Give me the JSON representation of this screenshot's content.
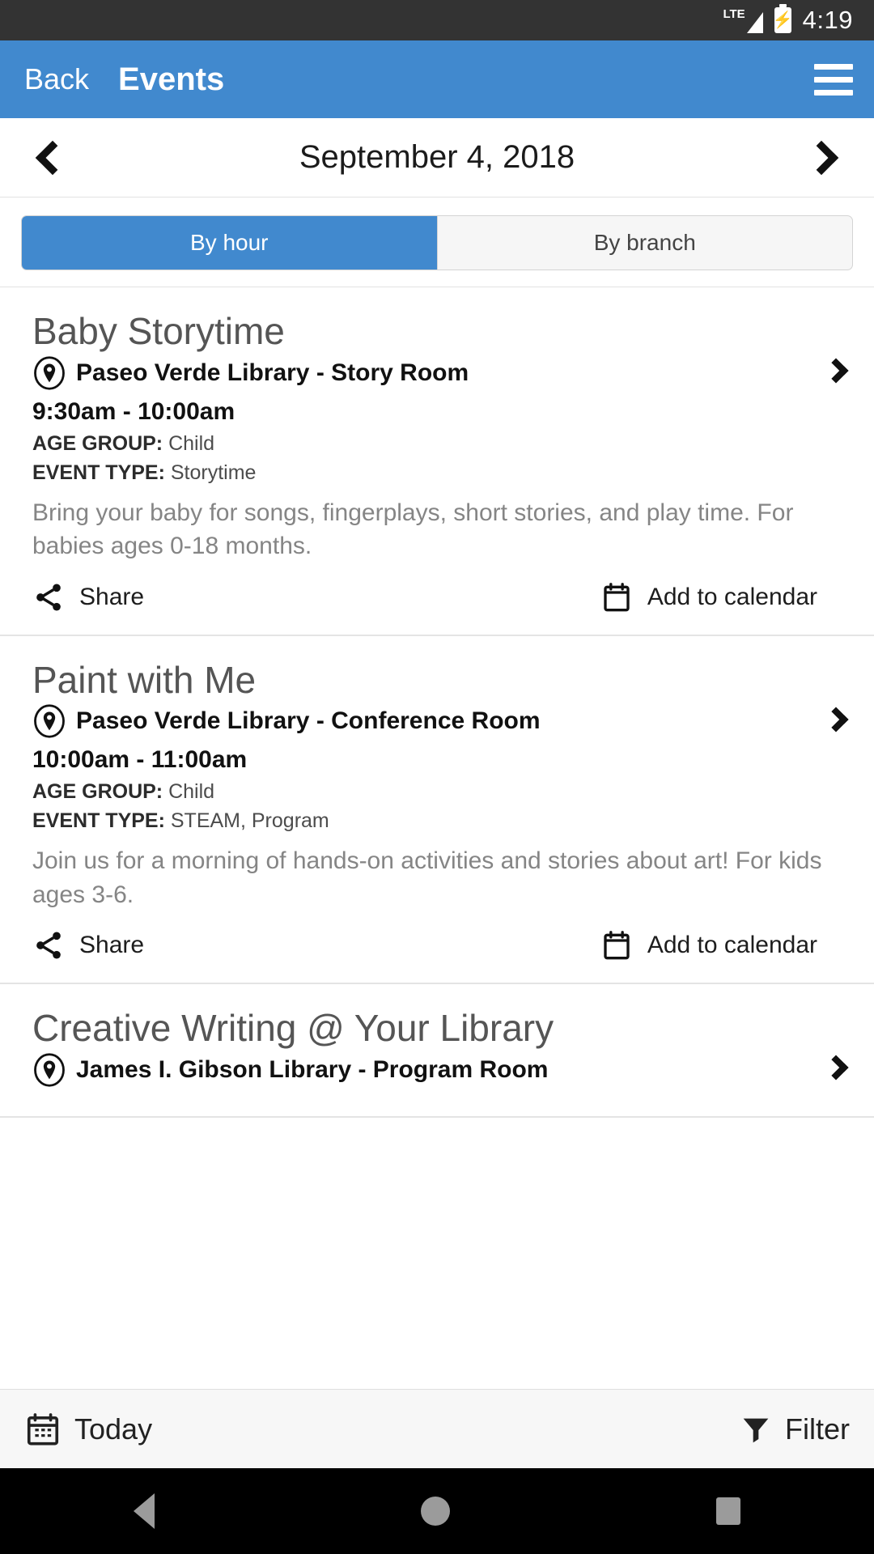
{
  "status_bar": {
    "network_label": "LTE",
    "time": "4:19",
    "battery_icon": "battery-charging-icon"
  },
  "app_bar": {
    "back_label": "Back",
    "title": "Events",
    "menu_icon": "hamburger-menu-icon",
    "background_color": "#4189ce"
  },
  "date_nav": {
    "prev_icon": "chevron-left-icon",
    "next_icon": "chevron-right-icon",
    "date": "September 4, 2018"
  },
  "tabs": {
    "active_index": 0,
    "items": [
      {
        "label": "By hour",
        "active": true
      },
      {
        "label": "By branch",
        "active": false
      }
    ]
  },
  "events": [
    {
      "title": "Baby Storytime",
      "location_icon": "map-pin-icon",
      "location": "Paseo Verde Library - Story Room",
      "time": "9:30am - 10:00am",
      "age_group_label": "AGE GROUP:",
      "age_group": "Child",
      "event_type_label": "EVENT TYPE:",
      "event_type": "Storytime",
      "description": "Bring your baby for songs, fingerplays, short stories, and play time. For babies ages 0-18 months.",
      "share_label": "Share",
      "share_icon": "share-icon",
      "calendar_label": "Add to calendar",
      "calendar_icon": "calendar-icon",
      "chevron_icon": "chevron-right-icon"
    },
    {
      "title": "Paint with Me",
      "location_icon": "map-pin-icon",
      "location": "Paseo Verde Library - Conference Room",
      "time": "10:00am - 11:00am",
      "age_group_label": "AGE GROUP:",
      "age_group": "Child",
      "event_type_label": "EVENT TYPE:",
      "event_type": "STEAM, Program",
      "description": "Join us for a morning of hands-on activities and stories about art! For kids ages 3-6.",
      "share_label": "Share",
      "share_icon": "share-icon",
      "calendar_label": "Add to calendar",
      "calendar_icon": "calendar-icon",
      "chevron_icon": "chevron-right-icon"
    },
    {
      "title": "Creative Writing @ Your Library",
      "location_icon": "map-pin-icon",
      "location": "James I. Gibson Library - Program Room",
      "chevron_icon": "chevron-right-icon"
    }
  ],
  "toolbar": {
    "today_label": "Today",
    "today_icon": "calendar-icon",
    "filter_label": "Filter",
    "filter_icon": "funnel-filter-icon"
  },
  "nav_bar": {
    "back_icon": "android-back-icon",
    "home_icon": "android-home-icon",
    "recents_icon": "android-recents-icon"
  }
}
